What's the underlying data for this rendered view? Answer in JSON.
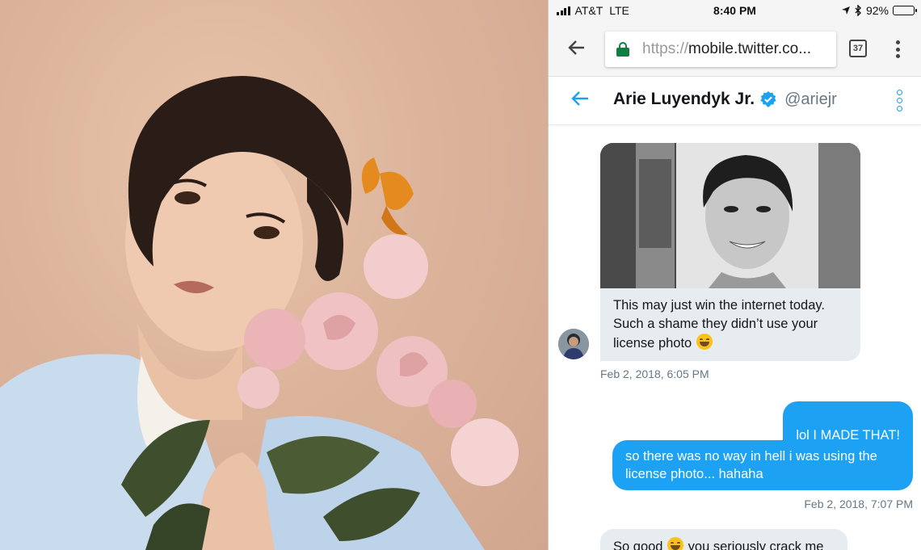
{
  "status_bar": {
    "carrier": "AT&T",
    "network": "LTE",
    "time": "8:40 PM",
    "battery": "92%",
    "battery_level": 0.92,
    "icons": [
      "signal-icon",
      "location-arrow-icon",
      "bluetooth-icon",
      "battery-icon"
    ]
  },
  "browser": {
    "url_scheme": "https://",
    "url_rest": "mobile.twitter.co...",
    "tab_count": "37",
    "icons": [
      "back-arrow-icon",
      "lock-icon",
      "menu-dots-icon"
    ]
  },
  "conversation": {
    "name": "Arie Luyendyk Jr.",
    "handle": "@ariejr",
    "icons": [
      "back-arrow-icon",
      "verified-badge-icon",
      "more-options-icon"
    ]
  },
  "messages": {
    "incoming_1": "This may just win the internet today. Such a shame they didn’t use your license photo",
    "incoming_1_time": "Feb 2, 2018, 6:05 PM",
    "outgoing_1": "lol I MADE THAT!",
    "outgoing_2": "so there was no way in hell i was using the license photo... hahaha",
    "outgoing_time": "Feb 2, 2018, 7:07 PM",
    "incoming_2_start": "So good",
    "incoming_2_rest": "you seriously crack me"
  },
  "colors": {
    "twitter_blue": "#1da1f2",
    "incoming_bubble": "#e6ecf0",
    "lock_green": "#0b8043"
  }
}
